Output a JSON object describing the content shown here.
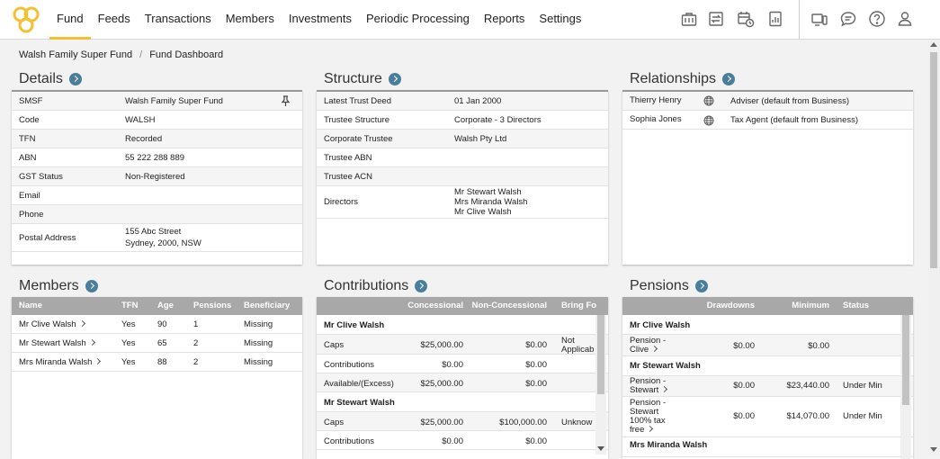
{
  "nav": {
    "items": [
      "Fund",
      "Feeds",
      "Transactions",
      "Members",
      "Investments",
      "Periodic Processing",
      "Reports",
      "Settings"
    ],
    "active": "Fund"
  },
  "breadcrumb": {
    "fund": "Walsh Family Super Fund",
    "separator": "/",
    "page": "Fund Dashboard"
  },
  "details": {
    "title": "Details",
    "rows": [
      {
        "label": "SMSF",
        "value": "Walsh Family Super Fund"
      },
      {
        "label": "Code",
        "value": "WALSH"
      },
      {
        "label": "TFN",
        "value": "Recorded"
      },
      {
        "label": "ABN",
        "value": "55 222 288 889"
      },
      {
        "label": "GST Status",
        "value": "Non-Registered"
      },
      {
        "label": "Email",
        "value": ""
      },
      {
        "label": "Phone",
        "value": ""
      },
      {
        "label": "Postal Address",
        "value": "155 Abc Street",
        "value2": "Sydney, 2000, NSW"
      }
    ]
  },
  "structure": {
    "title": "Structure",
    "rows": [
      {
        "label": "Latest Trust Deed",
        "value": "01 Jan 2000"
      },
      {
        "label": "Trustee Structure",
        "value": "Corporate - 3 Directors"
      },
      {
        "label": "Corporate Trustee",
        "value": "Walsh Pty Ltd"
      },
      {
        "label": "Trustee ABN",
        "value": ""
      },
      {
        "label": "Trustee ACN",
        "value": ""
      },
      {
        "label": "Directors",
        "lines": [
          "Mr Stewart Walsh",
          "Mrs Miranda Walsh",
          "Mr Clive Walsh"
        ]
      }
    ]
  },
  "relationships": {
    "title": "Relationships",
    "rows": [
      {
        "name": "Thierry Henry",
        "role": "Adviser (default from Business)"
      },
      {
        "name": "Sophia Jones",
        "role": "Tax Agent (default from Business)"
      }
    ]
  },
  "members": {
    "title": "Members",
    "headers": [
      "Name",
      "TFN",
      "Age",
      "Pensions",
      "Beneficiary"
    ],
    "rows": [
      {
        "name": "Mr Clive Walsh",
        "tfn": "Yes",
        "age": "90",
        "pensions": "1",
        "beneficiary": "Missing"
      },
      {
        "name": "Mr Stewart Walsh",
        "tfn": "Yes",
        "age": "65",
        "pensions": "2",
        "beneficiary": "Missing"
      },
      {
        "name": "Mrs Miranda Walsh",
        "tfn": "Yes",
        "age": "88",
        "pensions": "2",
        "beneficiary": "Missing"
      }
    ]
  },
  "contributions": {
    "title": "Contributions",
    "headers": [
      "",
      "Concessional",
      "Non-Concessional",
      "Bring Fo"
    ],
    "rows": [
      {
        "group": "Mr Clive Walsh"
      },
      {
        "label": "Caps",
        "concessional": "$25,000.00",
        "non_concessional": "$0.00",
        "bring": "Not",
        "bring2": "Applicab"
      },
      {
        "label": "Contributions",
        "concessional": "$0.00",
        "non_concessional": "$0.00",
        "bring": ""
      },
      {
        "label": "Available/(Excess)",
        "concessional": "$25,000.00",
        "non_concessional": "$0.00",
        "bring": ""
      },
      {
        "group": "Mr Stewart Walsh"
      },
      {
        "label": "Caps",
        "concessional": "$25,000.00",
        "non_concessional": "$100,000.00",
        "bring": "Unknow"
      },
      {
        "label": "Contributions",
        "concessional": "$0.00",
        "non_concessional": "$0.00",
        "bring": ""
      }
    ]
  },
  "pensions": {
    "title": "Pensions",
    "headers": [
      "",
      "Drawdowns",
      "Minimum",
      "Status"
    ],
    "rows": [
      {
        "group": "Mr Clive Walsh"
      },
      {
        "lines": [
          "Pension -",
          "Clive"
        ],
        "drawdowns": "$0.00",
        "minimum": "$0.00",
        "status": ""
      },
      {
        "group": "Mr Stewart Walsh"
      },
      {
        "lines": [
          "Pension -",
          "Stewart"
        ],
        "drawdowns": "$0.00",
        "minimum": "$23,440.00",
        "status": "Under Min"
      },
      {
        "lines": [
          "Pension -",
          "Stewart",
          "100% tax",
          "free"
        ],
        "drawdowns": "$0.00",
        "minimum": "$14,070.00",
        "status": "Under Min"
      },
      {
        "group": "Mrs Miranda Walsh"
      }
    ]
  }
}
